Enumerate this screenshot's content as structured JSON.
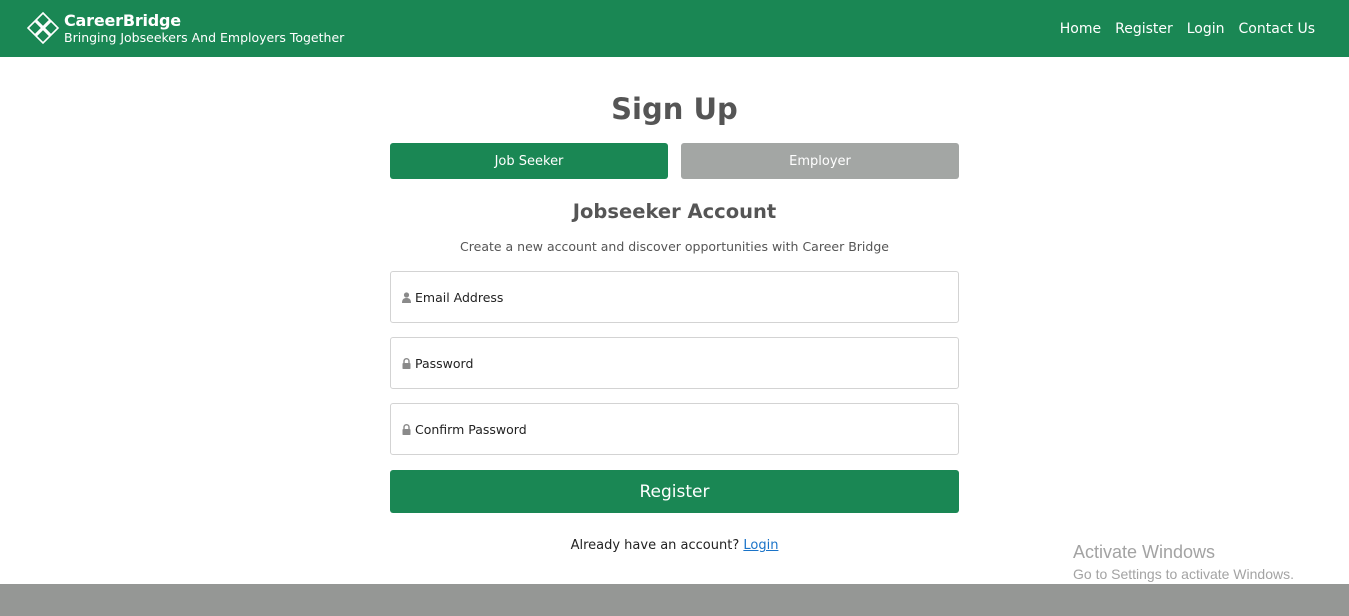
{
  "navbar": {
    "brand_name": "CareerBridge",
    "brand_tagline": "Bringing Jobseekers And Employers Together",
    "links": [
      "Home",
      "Register",
      "Login",
      "Contact Us"
    ],
    "color": "#1a8754"
  },
  "page": {
    "title": "Sign Up",
    "tabs": {
      "job_seeker": "Job Seeker",
      "employer": "Employer",
      "active": "job_seeker"
    },
    "account_title": "Jobseeker Account",
    "account_subtitle": "Create a new account and discover opportunities with Career Bridge",
    "fields": {
      "email": {
        "placeholder": "Email Address",
        "icon": "user-icon",
        "value": ""
      },
      "password": {
        "placeholder": "Password",
        "icon": "lock-icon",
        "value": ""
      },
      "confirm_password": {
        "placeholder": "Confirm Password",
        "icon": "lock-icon",
        "value": ""
      }
    },
    "register_label": "Register",
    "login_prompt": "Already have an account?",
    "login_link": "Login"
  },
  "overlay": {
    "activate_title": "Activate Windows",
    "activate_sub": "Go to Settings to activate Windows."
  },
  "colors": {
    "accent": "#1a8754",
    "inactive_tab": "#a3a6a4",
    "footer": "#959795",
    "link": "#1a73c8"
  }
}
